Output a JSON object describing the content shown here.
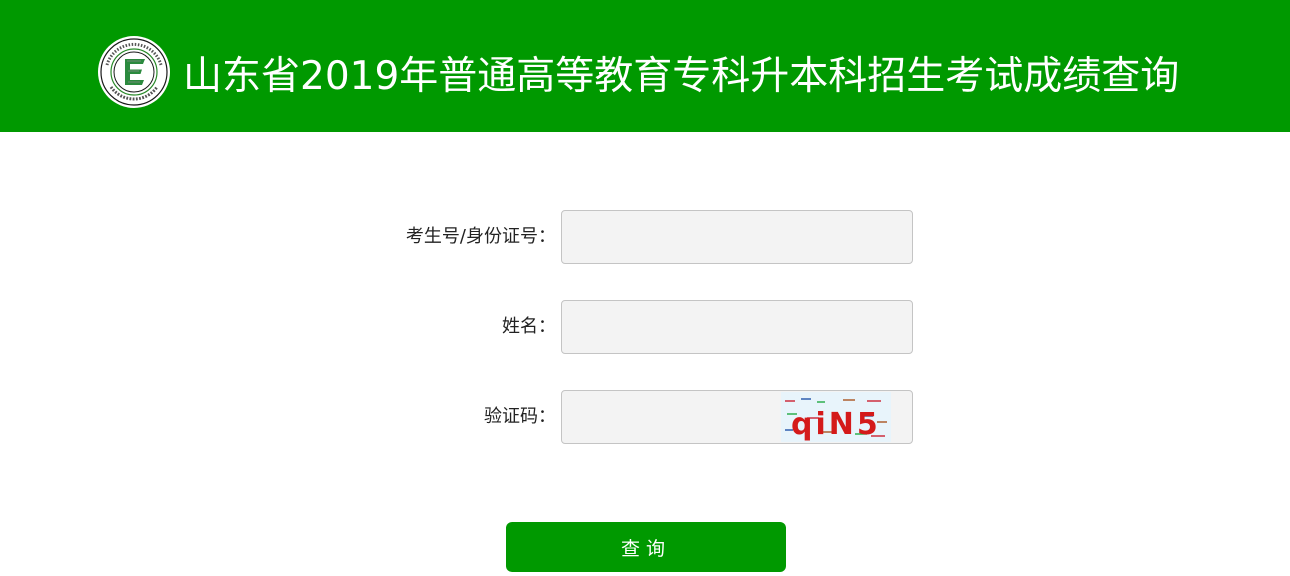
{
  "header": {
    "title": "山东省2019年普通高等教育专科升本科招生考试成绩查询",
    "background_color": "#009900",
    "logo_icon": "shandong-education-admissions-logo"
  },
  "form": {
    "id_label": "考生号/身份证号：",
    "id_value": "",
    "name_label": "姓名：",
    "name_value": "",
    "captcha_label": "验证码：",
    "captcha_value": "",
    "captcha_text": "qiN5"
  },
  "submit": {
    "label": "查询"
  }
}
